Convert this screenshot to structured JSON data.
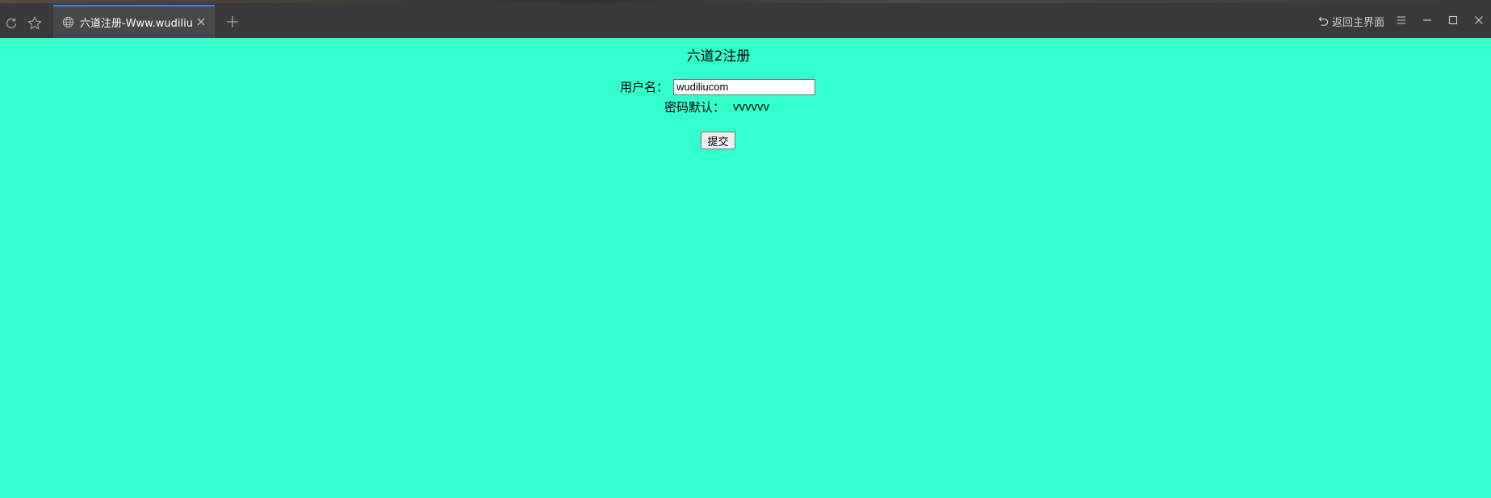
{
  "browser": {
    "tab_title": "六道注册-Www.wudiliu....",
    "return_home_label": "返回主界面"
  },
  "page": {
    "title": "六道2注册",
    "username_label": "用户名：",
    "username_value": "wudiliucom",
    "password_label": "密码默认：",
    "password_value": "vvvvvv",
    "submit_label": "提交"
  },
  "colors": {
    "background": "#33FFCC",
    "chrome": "#3a3a3d",
    "tab_active": "#48484c",
    "tab_accent": "#3b82f6"
  },
  "icons": {
    "reload": "reload-icon",
    "favorite": "star-icon",
    "tab_favicon": "globe-icon",
    "tab_close": "close-icon",
    "new_tab": "plus-icon",
    "return_home": "undo-icon",
    "menu": "menu-icon",
    "minimize": "minimize-icon",
    "maximize": "maximize-icon",
    "close_window": "close-window-icon"
  }
}
